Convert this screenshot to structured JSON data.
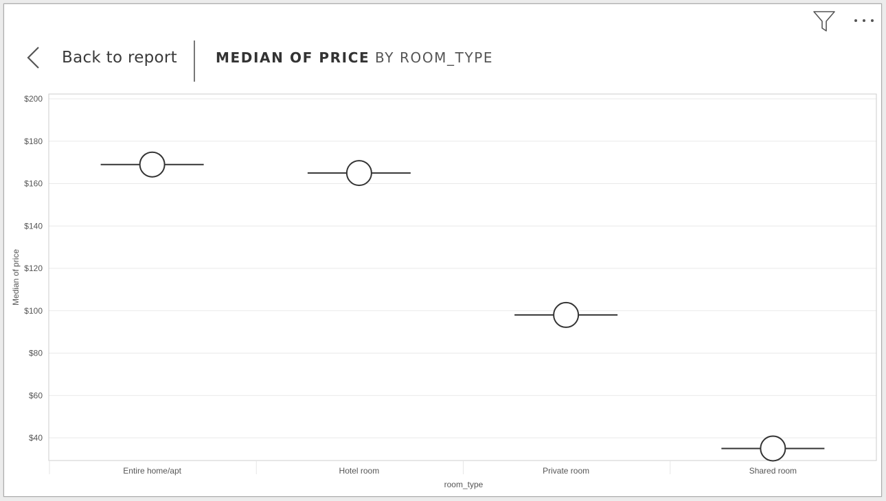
{
  "header": {
    "back_label": "Back to report",
    "title": "MEDIAN OF PRICE",
    "subtitle": "BY ROOM_TYPE"
  },
  "toolbar": {
    "filter_icon": "filter-funnel-icon",
    "more_icon": "more-options-icon"
  },
  "colors": {
    "mark": "#333333",
    "gridline": "#e9e9e9",
    "plot_border": "#cccccc",
    "text": "#555555"
  },
  "chart_data": {
    "type": "scatter",
    "title": "MEDIAN OF PRICE BY ROOM_TYPE",
    "xlabel": "room_type",
    "ylabel": "Median of price",
    "categories": [
      "Entire home/apt",
      "Hotel room",
      "Private room",
      "Shared room"
    ],
    "values": [
      169,
      165,
      98,
      35
    ],
    "value_format": "currency",
    "y_ticks": [
      "$40",
      "$60",
      "$80",
      "$100",
      "$120",
      "$140",
      "$160",
      "$180",
      "$200"
    ],
    "y_tick_values": [
      40,
      60,
      80,
      100,
      120,
      140,
      160,
      180,
      200
    ],
    "ylim": [
      30,
      200
    ],
    "grid": true,
    "legend": "none"
  }
}
